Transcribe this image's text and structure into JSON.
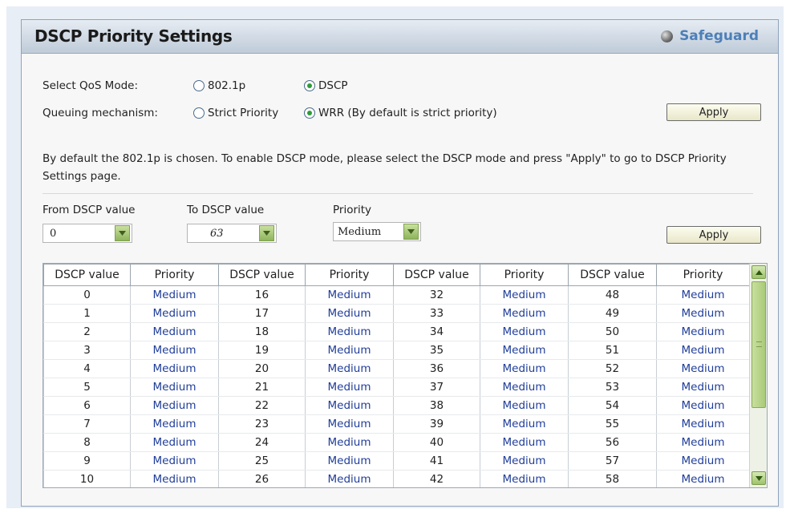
{
  "header": {
    "title": "DSCP Priority Settings",
    "brand": "Safeguard"
  },
  "mode": {
    "label": "Select QoS Mode:",
    "options": [
      "802.1p",
      "DSCP"
    ],
    "selected": "DSCP"
  },
  "queuing": {
    "label": "Queuing mechanism:",
    "options": [
      "Strict Priority",
      "WRR (By default is strict priority)"
    ],
    "selected": "WRR (By default is strict priority)"
  },
  "apply_top": "Apply",
  "info_text": "By default the 802.1p is chosen. To enable DSCP mode, please select the DSCP mode and press \"Apply\" to go to DSCP Priority Settings page.",
  "form": {
    "from_label": "From DSCP value",
    "from_value": "0",
    "to_label": "To DSCP value",
    "to_value": "63",
    "priority_label": "Priority",
    "priority_value": "Medium",
    "apply": "Apply"
  },
  "table": {
    "headers": [
      "DSCP value",
      "Priority",
      "DSCP value",
      "Priority",
      "DSCP value",
      "Priority",
      "DSCP value",
      "Priority"
    ],
    "rows": [
      [
        "0",
        "Medium",
        "16",
        "Medium",
        "32",
        "Medium",
        "48",
        "Medium"
      ],
      [
        "1",
        "Medium",
        "17",
        "Medium",
        "33",
        "Medium",
        "49",
        "Medium"
      ],
      [
        "2",
        "Medium",
        "18",
        "Medium",
        "34",
        "Medium",
        "50",
        "Medium"
      ],
      [
        "3",
        "Medium",
        "19",
        "Medium",
        "35",
        "Medium",
        "51",
        "Medium"
      ],
      [
        "4",
        "Medium",
        "20",
        "Medium",
        "36",
        "Medium",
        "52",
        "Medium"
      ],
      [
        "5",
        "Medium",
        "21",
        "Medium",
        "37",
        "Medium",
        "53",
        "Medium"
      ],
      [
        "6",
        "Medium",
        "22",
        "Medium",
        "38",
        "Medium",
        "54",
        "Medium"
      ],
      [
        "7",
        "Medium",
        "23",
        "Medium",
        "39",
        "Medium",
        "55",
        "Medium"
      ],
      [
        "8",
        "Medium",
        "24",
        "Medium",
        "40",
        "Medium",
        "56",
        "Medium"
      ],
      [
        "9",
        "Medium",
        "25",
        "Medium",
        "41",
        "Medium",
        "57",
        "Medium"
      ],
      [
        "10",
        "Medium",
        "26",
        "Medium",
        "42",
        "Medium",
        "58",
        "Medium"
      ]
    ]
  },
  "colors": {
    "priority_text": "#1f3d99",
    "brand": "#4d7fb8",
    "radio_checked": "#2e9b3a"
  },
  "icons": {
    "brand": "safeguard-dot-icon",
    "dropdown": "chevron-down-icon",
    "scroll_up": "chevron-up-icon",
    "scroll_down": "chevron-down-icon"
  }
}
